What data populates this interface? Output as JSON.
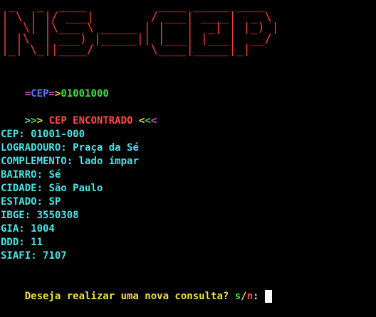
{
  "banner": {
    "art": " _   _  ____          ____ _____ ____  \n| \\ | |/ ___|        / ___| ____|  _ \\ \n|  \\| |\\___ \\ _____ | |   |  _| | |_) |\n| |\\  | ___) |_____|| |___| |___|  __/ \n|_| \\_||____/        \\____|_____|_|    "
  },
  "prompt": {
    "prefix_eq1": "=",
    "label": "CEP",
    "prefix_eq2": "=",
    "arrow": ">",
    "value": "01001000"
  },
  "status": {
    "open_1": ">",
    "open_2": ">",
    "open_3": ">",
    "text": " CEP ENCONTRADO ",
    "close_1": "<",
    "close_2": "<",
    "close_3": "<"
  },
  "fields": [
    {
      "key": "CEP:",
      "value": "01001-000"
    },
    {
      "key": "LOGRADOURO:",
      "value": "Praça da Sé"
    },
    {
      "key": "COMPLEMENTO:",
      "value": "lado ímpar"
    },
    {
      "key": "BAIRRO:",
      "value": "Sé"
    },
    {
      "key": "CIDADE:",
      "value": "São Paulo"
    },
    {
      "key": "ESTADO:",
      "value": "SP"
    },
    {
      "key": "IBGE:",
      "value": "3550308"
    },
    {
      "key": "GIA:",
      "value": "1004"
    },
    {
      "key": "DDD:",
      "value": "11"
    },
    {
      "key": "SIAFI:",
      "value": "7107"
    }
  ],
  "question": {
    "text": "Deseja realizar uma nova consulta? ",
    "yes": "s",
    "slash": "/",
    "no": "n",
    "colon": ": "
  },
  "colors": {
    "background": "#000000",
    "banner": "#ff3b3b",
    "cyan": "#4fe3e3",
    "green": "#3fe03f",
    "red": "#ff4b4b",
    "blue": "#5a78ff",
    "magenta": "#e04be0",
    "yellow": "#f0e04b"
  }
}
